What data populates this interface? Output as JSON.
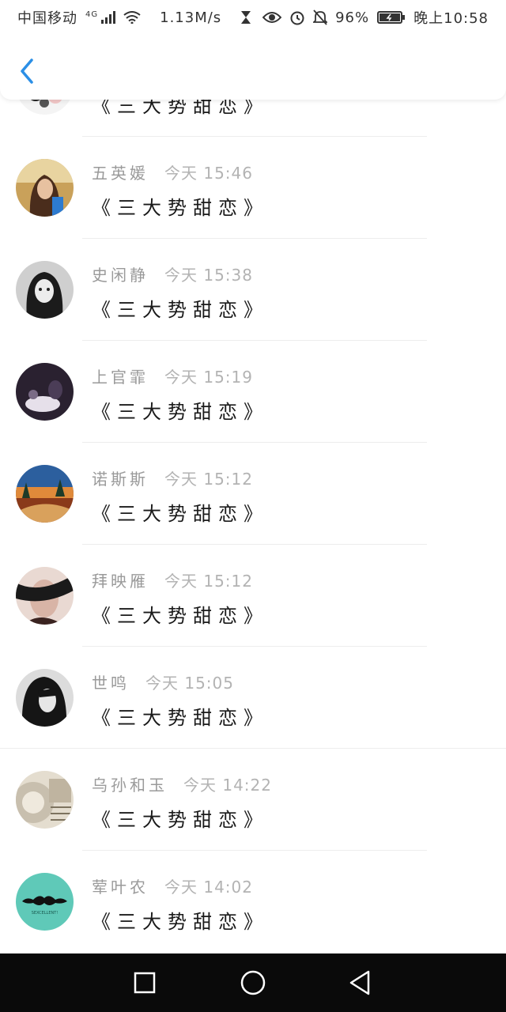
{
  "status": {
    "carrier": "中国移动",
    "network": "4G",
    "speed": "1.13M/s",
    "battery": "96%",
    "time": "晚上10:58"
  },
  "icons": {
    "back": "back-arrow-icon",
    "signal": "signal-icon",
    "wifi": "wifi-icon",
    "hourglass": "hourglass-icon",
    "eye": "eye-icon",
    "alarm": "alarm-icon",
    "mute": "bell-off-icon",
    "battery": "battery-icon",
    "nav_recent": "square-icon",
    "nav_home": "circle-icon",
    "nav_back": "triangle-back-icon"
  },
  "colors": {
    "accent": "#2b8fe6",
    "name_gray": "#9a9a9a",
    "msg_black": "#1a1a1a"
  },
  "items": [
    {
      "name": "",
      "time": "",
      "message": "《三大势甜恋》"
    },
    {
      "name": "五英媛",
      "time": "今天 15:46",
      "message": "《三大势甜恋》"
    },
    {
      "name": "史闲静",
      "time": "今天 15:38",
      "message": "《三大势甜恋》"
    },
    {
      "name": "上官霏",
      "time": "今天 15:19",
      "message": "《三大势甜恋》"
    },
    {
      "name": "诺斯斯",
      "time": "今天 15:12",
      "message": "《三大势甜恋》"
    },
    {
      "name": "拜映雁",
      "time": "今天 15:12",
      "message": "《三大势甜恋》"
    },
    {
      "name": "世鸣",
      "time": "今天 15:05",
      "message": "《三大势甜恋》"
    },
    {
      "name": "乌孙和玉",
      "time": "今天 14:22",
      "message": "《三大势甜恋》"
    },
    {
      "name": "荤叶农",
      "time": "今天 14:02",
      "message": "《三大势甜恋》"
    }
  ],
  "avatar_badge": "SEXCELLENT!"
}
